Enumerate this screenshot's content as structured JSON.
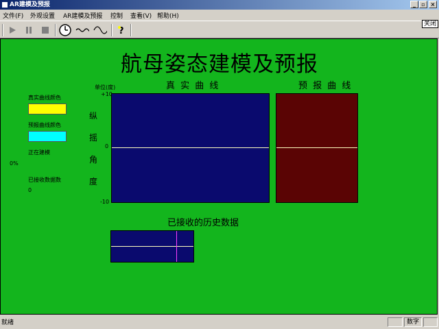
{
  "window": {
    "title": "AR建模及预报",
    "minimize": "_",
    "restore": "▫",
    "close": "×"
  },
  "menu": [
    "文件(F)",
    "外观设置",
    "AR建模及预报",
    "控制",
    "查看(V)",
    "帮助(H)"
  ],
  "toolbar": {
    "close_label": "关闭"
  },
  "main": {
    "title": "航母姿态建模及预报",
    "real_curve_title": "真 实 曲 线",
    "forecast_curve_title": "预 报 曲 线",
    "unit_label": "单位(度)",
    "y_top": "+10",
    "y_mid": "0",
    "y_bottom": "-10",
    "axis_chars": [
      "纵",
      "摇",
      "角",
      "度"
    ],
    "real_color_label": "真实曲线颜色",
    "forecast_color_label": "预报曲线颜色",
    "status_label": "正在建模",
    "progress_text": "0%",
    "received_label": "已接收数据数",
    "received_count": "0",
    "history_title": "已接收的历史数据"
  },
  "colors": {
    "real_curve": "#ffff00",
    "forecast_curve": "#00ffff",
    "background": "#13b51d",
    "real_panel": "#0a0a6e",
    "forecast_panel": "#5a0404"
  },
  "status": {
    "text": "就绪",
    "num": "数字"
  }
}
